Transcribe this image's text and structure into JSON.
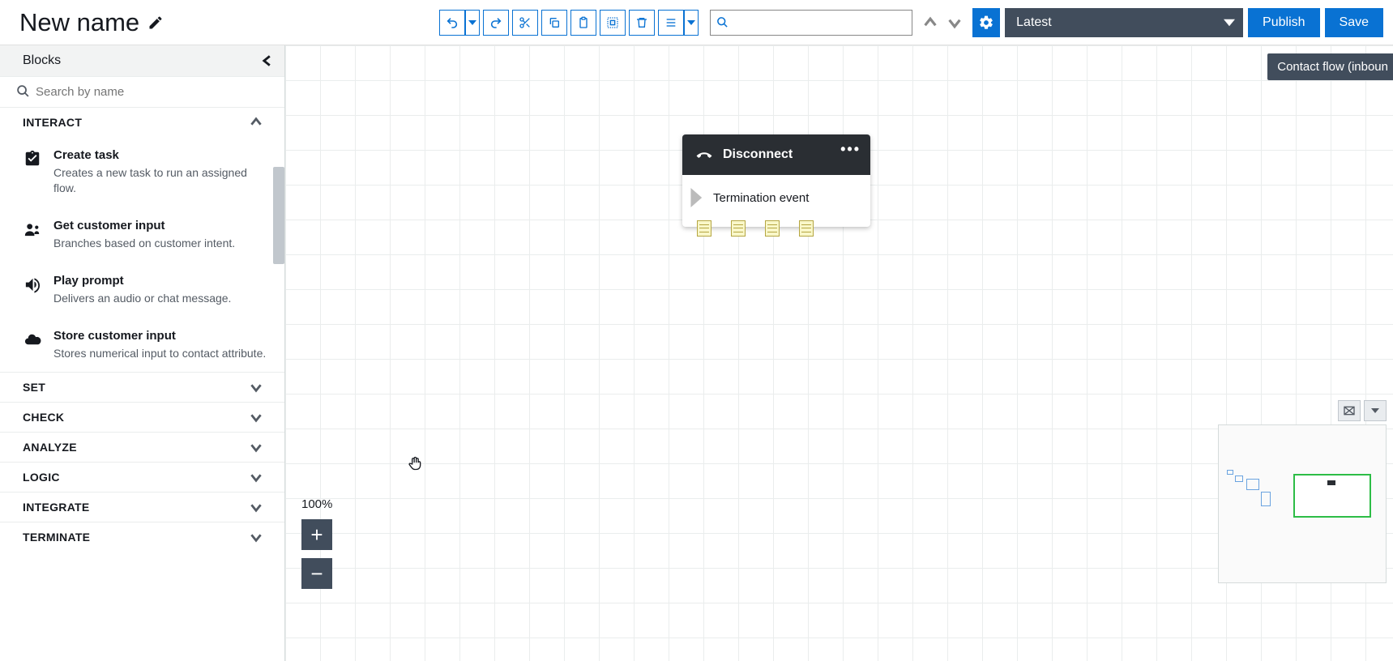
{
  "header": {
    "title": "New name",
    "search_placeholder": "",
    "version_label": "Latest",
    "publish_label": "Publish",
    "save_label": "Save"
  },
  "sidebar": {
    "title": "Blocks",
    "search_placeholder": "Search by name",
    "categories": [
      {
        "id": "interact",
        "label": "INTERACT",
        "expanded": true
      },
      {
        "id": "set",
        "label": "SET",
        "expanded": false
      },
      {
        "id": "check",
        "label": "CHECK",
        "expanded": false
      },
      {
        "id": "analyze",
        "label": "ANALYZE",
        "expanded": false
      },
      {
        "id": "logic",
        "label": "LOGIC",
        "expanded": false
      },
      {
        "id": "integrate",
        "label": "INTEGRATE",
        "expanded": false
      },
      {
        "id": "terminate",
        "label": "TERMINATE",
        "expanded": false
      }
    ],
    "interact_blocks": [
      {
        "icon": "task",
        "title": "Create task",
        "desc": "Creates a new task to run an assigned flow."
      },
      {
        "icon": "customer",
        "title": "Get customer input",
        "desc": "Branches based on customer intent."
      },
      {
        "icon": "audio",
        "title": "Play prompt",
        "desc": "Delivers an audio or chat message."
      },
      {
        "icon": "store",
        "title": "Store customer input",
        "desc": "Stores numerical input to contact attribute."
      }
    ]
  },
  "canvas": {
    "node": {
      "title": "Disconnect",
      "body": "Termination event"
    },
    "zoom_pct": "100%",
    "badge": "Contact flow (inboun"
  }
}
